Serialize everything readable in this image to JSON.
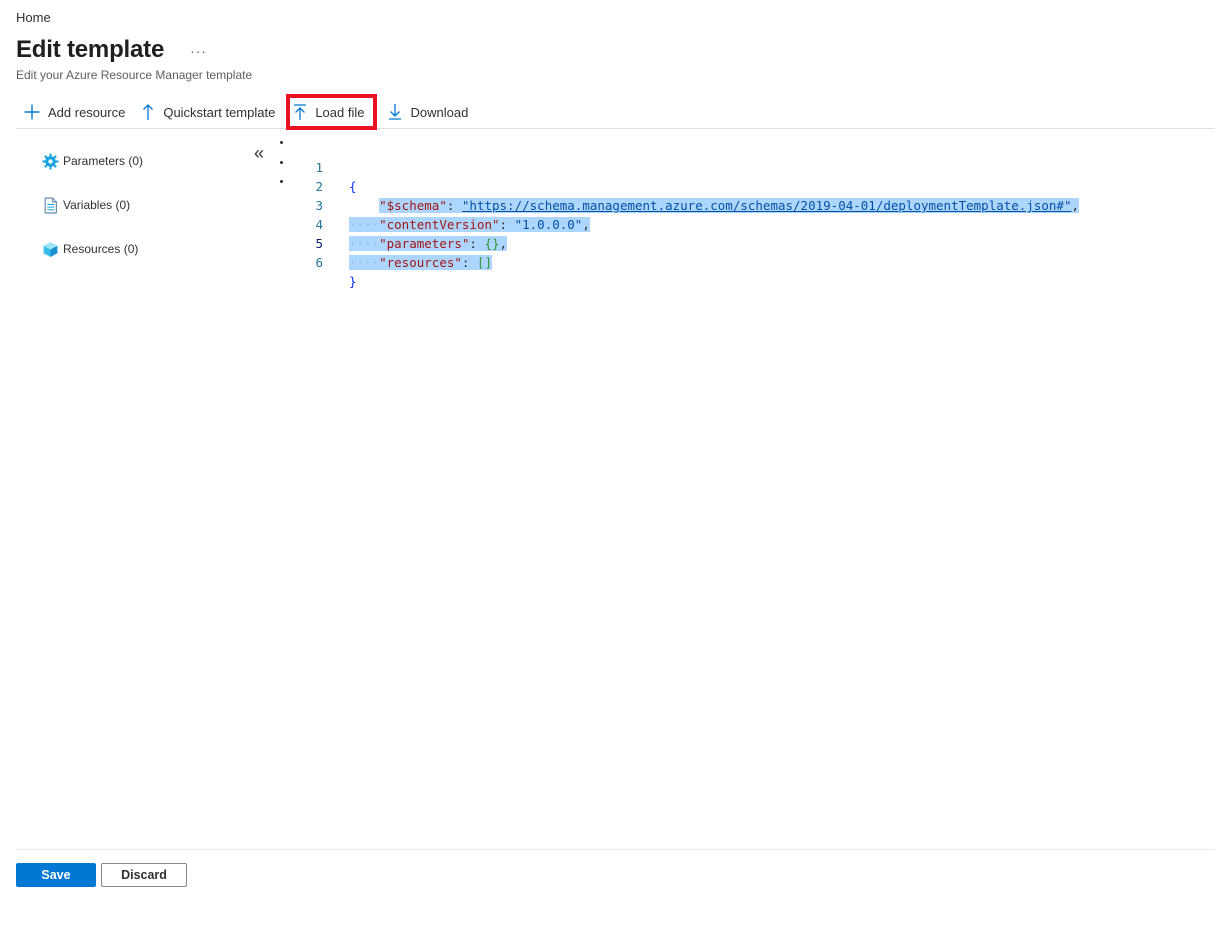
{
  "breadcrumb": {
    "home": "Home"
  },
  "header": {
    "title": "Edit template",
    "more": "···",
    "subtitle": "Edit your Azure Resource Manager template"
  },
  "toolbar": {
    "add_resource": "Add resource",
    "quickstart_template": "Quickstart template",
    "load_file": "Load file",
    "download": "Download"
  },
  "side_nav": {
    "parameters": "Parameters (0)",
    "variables": "Variables (0)",
    "resources": "Resources (0)",
    "collapse": "«"
  },
  "editor": {
    "line_numbers": [
      "1",
      "2",
      "3",
      "4",
      "5",
      "6"
    ],
    "active_line": "5",
    "open_brace": "{",
    "close_brace": "}",
    "schema_key": "\"$schema\"",
    "schema_value": "\"https://schema.management.azure.com/schemas/2019-04-01/deploymentTemplate.json#\"",
    "content_version_key": "\"contentVersion\"",
    "content_version_value": "\"1.0.0.0\"",
    "parameters_key": "\"parameters\"",
    "parameters_value": "{}",
    "resources_key": "\"resources\"",
    "resources_value": "[]"
  },
  "footer": {
    "save": "Save",
    "discard": "Discard"
  },
  "colors": {
    "primary": "#0078d4",
    "highlight_box": "#e81123",
    "selection": "#add6ff",
    "json_key": "#a31515",
    "json_string": "#0451a5"
  }
}
